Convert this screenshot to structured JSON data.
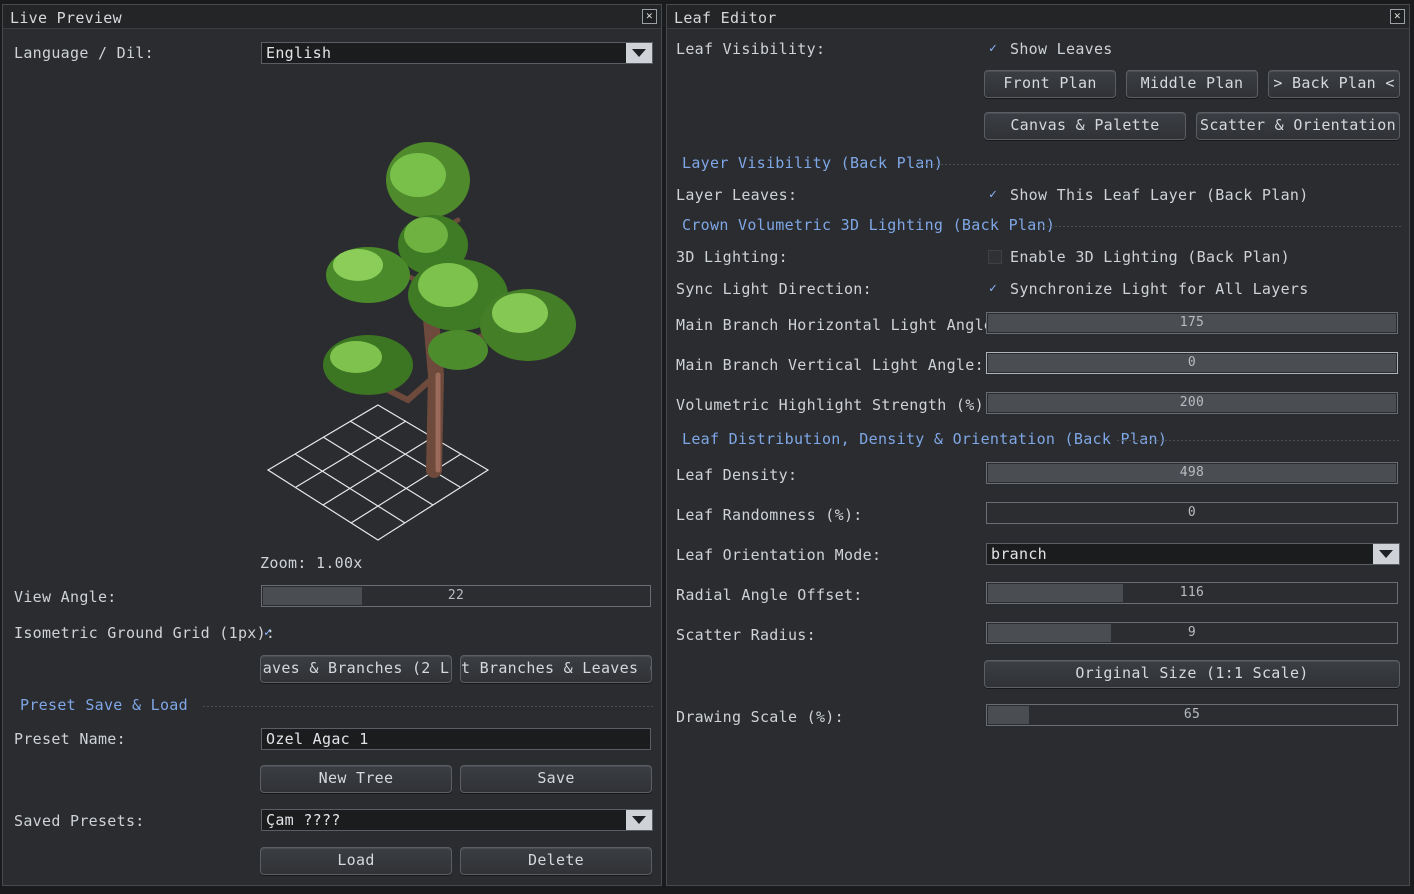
{
  "live_preview": {
    "title": "Live Preview",
    "close_icon": "✕",
    "language_label": "Language / Dil:",
    "language_value": "English",
    "zoom_text": "Zoom: 1.00x",
    "view_angle_label": "View Angle:",
    "view_angle_value": 22,
    "view_angle_fraction": 0.26,
    "iso_grid_label": "Isometric Ground Grid (1px):",
    "iso_grid_checked": true,
    "layer_btn_1": "aves & Branches (2 L",
    "layer_btn_2": "t Branches & Leaves (",
    "preset_section": "Preset Save & Load",
    "preset_name_label": "Preset Name:",
    "preset_name_value": "Ozel Agac 1",
    "new_tree_label": "New Tree",
    "save_label": "Save",
    "saved_presets_label": "Saved Presets:",
    "saved_presets_value": "Çam ????",
    "load_label": "Load",
    "delete_label": "Delete"
  },
  "leaf_editor": {
    "title": "Leaf Editor",
    "close_icon": "✕",
    "leaf_visibility_label": "Leaf Visibility:",
    "show_leaves_label": "Show Leaves",
    "show_leaves_checked": true,
    "front_plan": "Front Plan",
    "middle_plan": "Middle Plan",
    "back_plan": "> Back Plan <",
    "canvas_palette": "Canvas & Palette",
    "scatter_orientation": "Scatter & Orientation",
    "layer_visibility_section": "Layer Visibility (Back Plan)",
    "layer_leaves_label": "Layer Leaves:",
    "show_layer_label": "Show This Leaf Layer (Back Plan)",
    "crown_section": "Crown Volumetric 3D Lighting (Back Plan)",
    "lighting_label": "3D Lighting:",
    "enable_lighting_label": "Enable 3D Lighting (Back Plan)",
    "sync_label": "Sync Light Direction:",
    "sync_value_label": "Synchronize Light for All Layers",
    "h_angle_label": "Main Branch Horizontal Light Angle:",
    "h_angle_value": 175,
    "v_angle_label": "Main Branch Vertical Light Angle:",
    "v_angle_value": 0,
    "highlight_label": "Volumetric Highlight Strength (%):",
    "highlight_value": 200,
    "distribution_section": "Leaf Distribution, Density & Orientation (Back Plan)",
    "density_label": "Leaf Density:",
    "density_value": 498,
    "randomness_label": "Leaf Randomness (%):",
    "randomness_value": 0,
    "orientation_label": "Leaf Orientation Mode:",
    "orientation_value": "branch",
    "radial_label": "Radial Angle Offset:",
    "radial_value": 116,
    "radial_fraction": 0.33,
    "scatter_label": "Scatter Radius:",
    "scatter_value": 9,
    "scatter_fraction": 0.3,
    "original_size_label": "Original Size (1:1 Scale)",
    "drawing_scale_label": "Drawing Scale (%):",
    "drawing_scale_value": 65,
    "drawing_scale_fraction": 0.1
  }
}
